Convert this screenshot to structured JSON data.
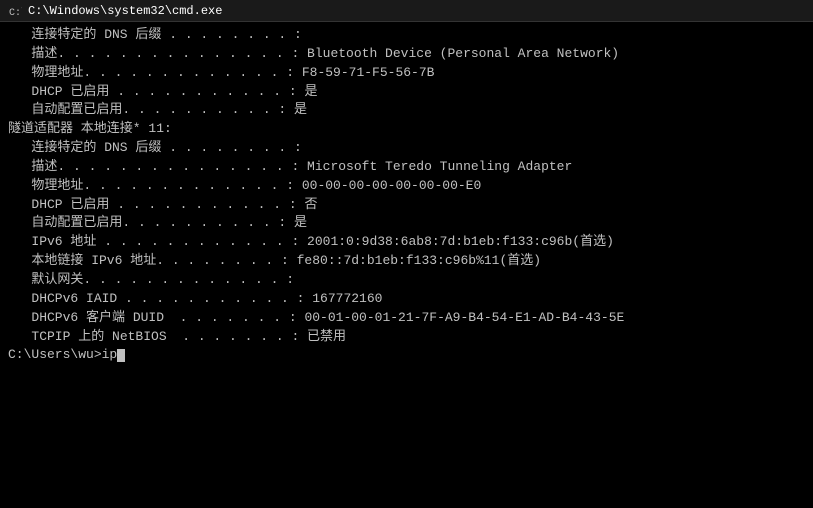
{
  "titleBar": {
    "icon": "▶",
    "text": "C:\\Windows\\system32\\cmd.exe"
  },
  "lines": [
    "   连接特定的 DNS 后缀 . . . . . . . . :",
    "   描述. . . . . . . . . . . . . . . : Bluetooth Device (Personal Area Network)",
    "   物理地址. . . . . . . . . . . . . : F8-59-71-F5-56-7B",
    "   DHCP 已启用 . . . . . . . . . . . : 是",
    "   自动配置已启用. . . . . . . . . . : 是",
    "",
    "隧道适配器 本地连接* 11:",
    "",
    "   连接特定的 DNS 后缀 . . . . . . . . :",
    "   描述. . . . . . . . . . . . . . . : Microsoft Teredo Tunneling Adapter",
    "   物理地址. . . . . . . . . . . . . : 00-00-00-00-00-00-00-E0",
    "   DHCP 已启用 . . . . . . . . . . . : 否",
    "   自动配置已启用. . . . . . . . . . : 是",
    "   IPv6 地址 . . . . . . . . . . . . : 2001:0:9d38:6ab8:7d:b1eb:f133:c96b(首选)",
    "   本地链接 IPv6 地址. . . . . . . . : fe80::7d:b1eb:f133:c96b%11(首选)",
    "   默认网关. . . . . . . . . . . . . :",
    "   DHCPv6 IAID . . . . . . . . . . . : 167772160",
    "   DHCPv6 客户端 DUID  . . . . . . . : 00-01-00-01-21-7F-A9-B4-54-E1-AD-B4-43-5E",
    "   TCPIP 上的 NetBIOS  . . . . . . . : 已禁用",
    "",
    "C:\\Users\\wu>ip"
  ]
}
